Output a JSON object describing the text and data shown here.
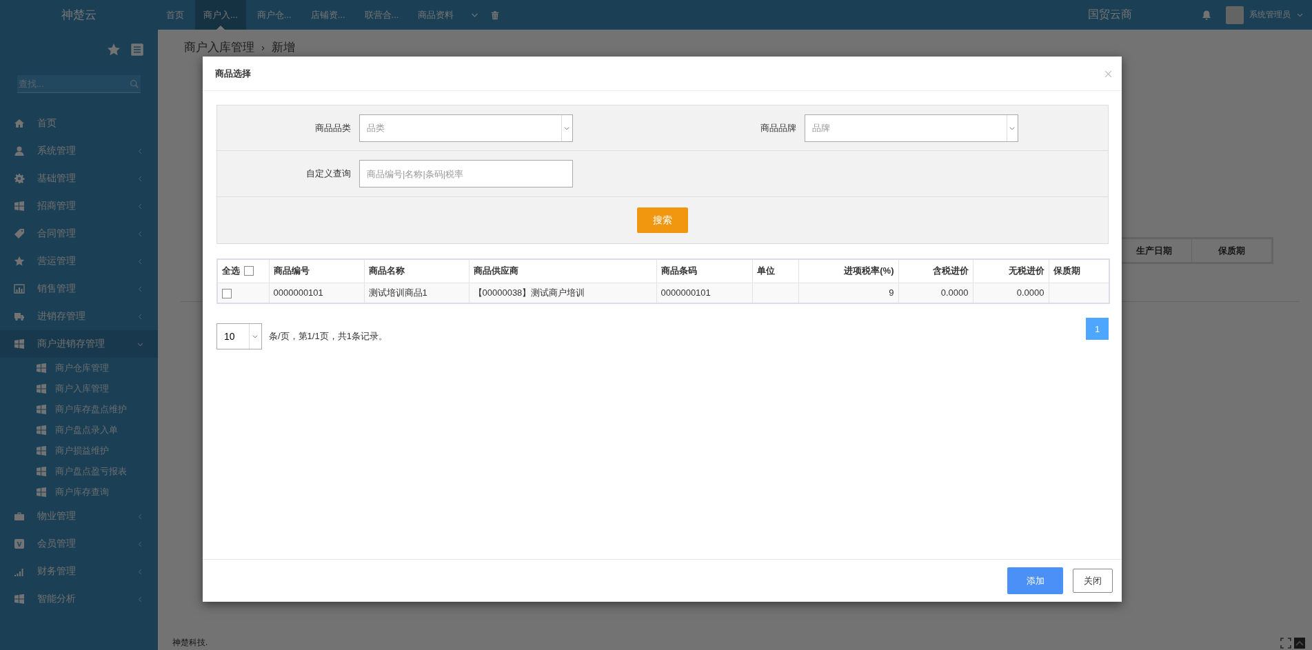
{
  "top_bar": {
    "logo": "神楚云",
    "nav": [
      {
        "label": "首页",
        "selected": false
      },
      {
        "label": "商户入...",
        "selected": true
      },
      {
        "label": "商户仓...",
        "selected": false
      },
      {
        "label": "店铺资...",
        "selected": false
      },
      {
        "label": "联营合...",
        "selected": false
      },
      {
        "label": "商品资料",
        "selected": false
      }
    ],
    "brand": "国贸云商",
    "user": "系统管理员"
  },
  "sidebar": {
    "search": {
      "placeholder": "查找..."
    },
    "items": [
      {
        "label": "首页"
      },
      {
        "label": "系统管理",
        "expanded": false
      },
      {
        "label": "基础管理",
        "expanded": false
      },
      {
        "label": "招商管理",
        "expanded": false
      },
      {
        "label": "合同管理",
        "expanded": false
      },
      {
        "label": "营运管理",
        "expanded": false
      },
      {
        "label": "销售管理",
        "expanded": false
      },
      {
        "label": "进销存管理",
        "expanded": false
      },
      {
        "label": "商户进销存管理",
        "expanded": true,
        "children": [
          {
            "label": "商户仓库管理"
          },
          {
            "label": "商户入库管理"
          },
          {
            "label": "商户库存盘点维护"
          },
          {
            "label": "商户盘点录入单"
          },
          {
            "label": "商户损益维护"
          },
          {
            "label": "商户盘点盈亏报表"
          },
          {
            "label": "商户库存查询"
          }
        ]
      },
      {
        "label": "物业管理",
        "expanded": false
      },
      {
        "label": "会员管理",
        "expanded": false
      },
      {
        "label": "财务管理",
        "expanded": false
      },
      {
        "label": "智能分析",
        "expanded": false
      }
    ]
  },
  "content": {
    "breadcrumb": {
      "items": [
        "商户入库管理",
        "新增"
      ],
      "separator": "›"
    },
    "table_columns": [
      "生产日期",
      "保质期"
    ],
    "footer": "神楚科技."
  },
  "modal": {
    "title": "商品选择",
    "filters": [
      {
        "label": "商品品类",
        "kind": "select",
        "placeholder": "品类"
      },
      {
        "label": "商品品牌",
        "kind": "select",
        "placeholder": "品牌"
      },
      {
        "label": "自定义查询",
        "kind": "text",
        "placeholder": "商品编号|名称|条码|税率"
      }
    ],
    "search_button": "搜索",
    "table": {
      "select_all": {
        "label": "全选",
        "checked": false
      },
      "columns": [
        "商品编号",
        "商品名称",
        "商品供应商",
        "商品条码",
        "单位",
        "进项税率(%)",
        "含税进价",
        "无税进价",
        "保质期"
      ],
      "rows": [
        {
          "selected": false,
          "cells": [
            "0000000101",
            "测试培训商品1",
            "【00000038】测试商户培训",
            "0000000101",
            "",
            "9",
            "0.0000",
            "0.0000",
            ""
          ]
        }
      ]
    },
    "pagination": {
      "page_size": "10",
      "summary": "条/页，第1/1页，共1条记录。",
      "pages": [
        {
          "label": "1",
          "selected": true
        }
      ]
    },
    "buttons": [
      {
        "label": "添加",
        "kind": "primary"
      },
      {
        "label": "关闭",
        "kind": "default"
      }
    ]
  }
}
